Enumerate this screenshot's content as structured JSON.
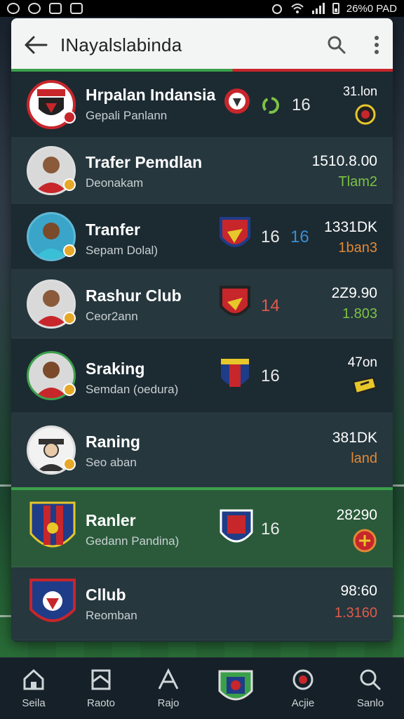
{
  "status_bar": {
    "right_text": "26%0 PAD"
  },
  "appbar": {
    "title": "INayalslabinda",
    "back_icon": "arrow-left-icon",
    "search_icon": "search-icon",
    "menu_icon": "more-vertical-icon"
  },
  "rows": [
    {
      "primary": "Hrpalan Indansia",
      "secondary": "Gepali Panlann",
      "mid_number": "16",
      "right_top": "31.lon",
      "right_bottom": ""
    },
    {
      "primary": "Trafer Pemdlan",
      "secondary": "Deonakam",
      "mid_number": "",
      "right_top": "1510.8.00",
      "right_bottom": "Tlam2"
    },
    {
      "primary": "Tranfer",
      "secondary": "Sepam Dolal)",
      "mid_number": "16",
      "mid_number_2": "16",
      "right_top": "1331DK",
      "right_bottom": "1ban3"
    },
    {
      "primary": "Rashur Club",
      "secondary": "Ceor2ann",
      "mid_number": "14",
      "right_top": "2Z9.90",
      "right_bottom": "1.803"
    },
    {
      "primary": "Sraking",
      "secondary": "Semdan (oedura)",
      "mid_number": "16",
      "right_top": "47on",
      "right_bottom": ""
    },
    {
      "primary": "Raning",
      "secondary": "Seo aban",
      "mid_number": "",
      "right_top": "381DK",
      "right_bottom": "land"
    },
    {
      "primary": "Ranler",
      "secondary": "Gedann Pandina)",
      "mid_number": "16",
      "right_top": "28290",
      "right_bottom": ""
    },
    {
      "primary": "Cllub",
      "secondary": "Reomban",
      "mid_number": "",
      "right_top": "98:60",
      "right_bottom": "1.3160"
    }
  ],
  "bottom_nav": [
    {
      "label": "Seila",
      "icon": "home-icon"
    },
    {
      "label": "Raoto",
      "icon": "flag-icon"
    },
    {
      "label": "Rajo",
      "icon": "rank-icon"
    },
    {
      "label": "",
      "icon": "club-crest-icon"
    },
    {
      "label": "Acjie",
      "icon": "badge-icon"
    },
    {
      "label": "Sanlo",
      "icon": "search-icon"
    }
  ],
  "colors": {
    "accent_green": "#3ba04a",
    "accent_red": "#c7262b",
    "value_green": "#7cc244",
    "value_orange": "#e18a35",
    "value_blue": "#3a8fd1"
  }
}
